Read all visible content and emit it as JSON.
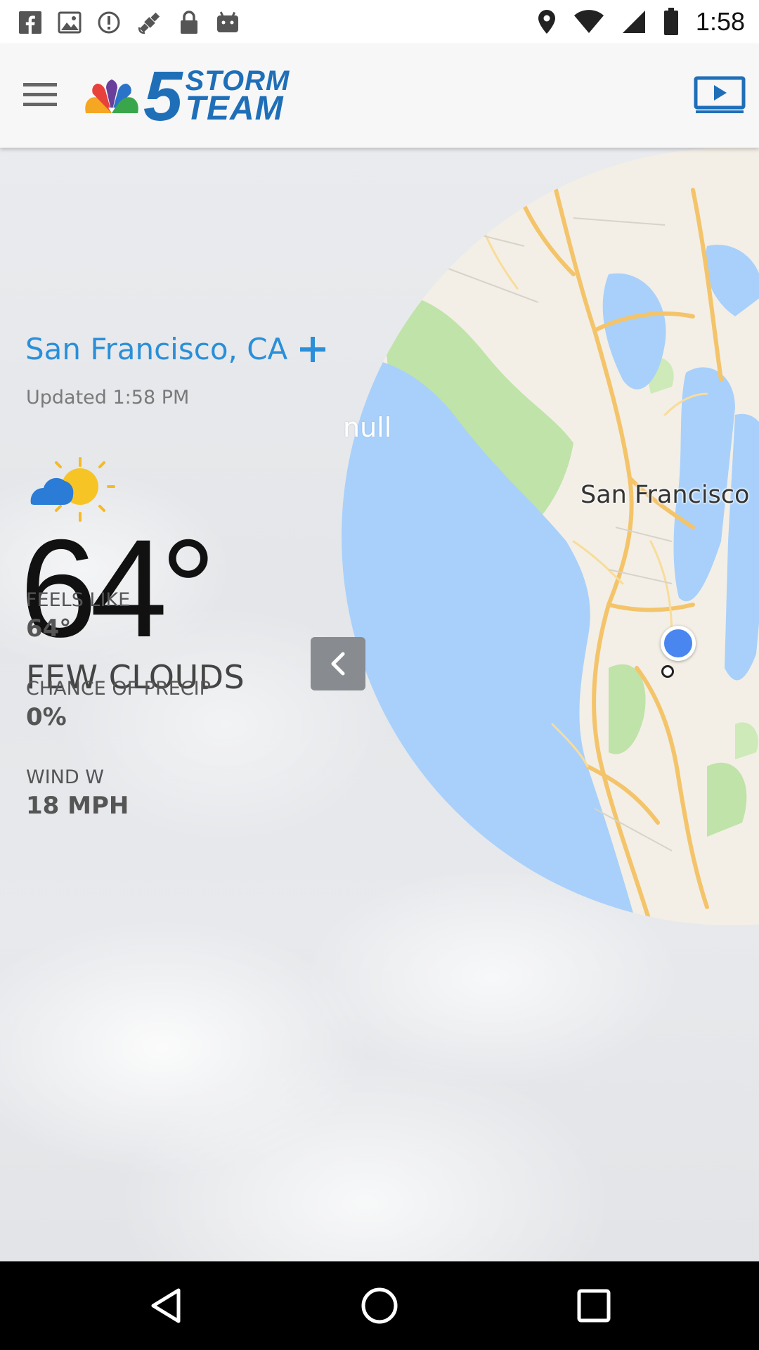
{
  "status_bar": {
    "time": "1:58",
    "icons": [
      "facebook-icon",
      "image-icon",
      "sync-icon",
      "satellite-icon",
      "lock-icon",
      "android-icon",
      "location-icon",
      "wifi-icon",
      "signal-icon",
      "battery-icon"
    ]
  },
  "header": {
    "brand_number": "5",
    "brand_line1": "STORM",
    "brand_line2": "TEAM",
    "brand_color": "#1f6fb8"
  },
  "weather": {
    "location": "San Francisco, CA",
    "updated": "Updated 1:58 PM",
    "null_label": "null",
    "temperature": "64°",
    "condition": "FEW CLOUDS",
    "condition_icon": "partly-cloudy-icon",
    "accent_color": "#2a8fd8",
    "stats": [
      {
        "label": "FEELS LIKE",
        "value": "64°"
      },
      {
        "label": "CHANCE OF PRECIP",
        "value": "0%"
      },
      {
        "label": "WIND W",
        "value": "18 MPH"
      }
    ]
  },
  "map": {
    "city_label": "San Francisco",
    "water_color": "#a8d0fb",
    "land_color": "#f3efe6",
    "park_color": "#bfe3a8",
    "road_color": "#f4c46a"
  },
  "nav_bar": {
    "buttons": [
      "back-icon",
      "home-icon",
      "recents-icon"
    ]
  }
}
